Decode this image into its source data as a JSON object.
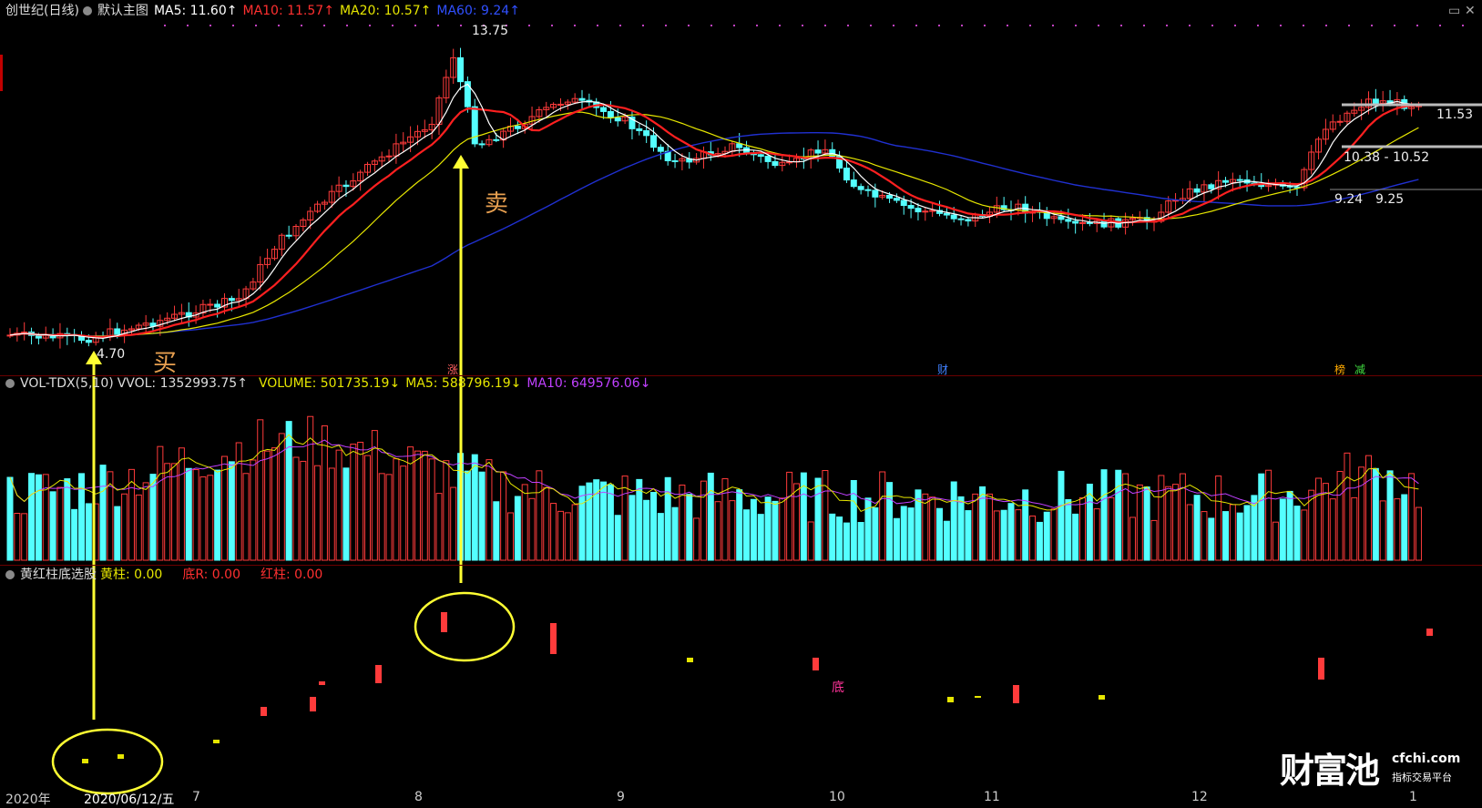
{
  "header_main": {
    "title": "创世纪(日线)",
    "template": "默认主图",
    "ma5": "MA5: 11.60↑",
    "ma10": "MA10: 11.57↑",
    "ma20": "MA20: 10.57↑",
    "ma60": "MA60: 9.24↑"
  },
  "header_vol": {
    "name": "VOL-TDX(5,10)",
    "vvol": "VVOL: 1352993.75↑",
    "volume": "VOLUME: 501735.19↓",
    "ma5": "MA5: 588796.19↓",
    "ma10": "MA10: 649576.06↓"
  },
  "header_ind": {
    "name": "黄红柱底选股",
    "yellow": "黄柱: 0.00",
    "bottom": "底R: 0.00",
    "red": "红柱: 0.00"
  },
  "price_labels": {
    "high": "13.75",
    "low": "4.70",
    "right": "11.53",
    "range": "10.38 - 10.52",
    "ma60_a": "9.24",
    "ma60_b": "9.25"
  },
  "annotations": {
    "buy": "买",
    "sell": "卖",
    "bottom": "底"
  },
  "event_marks": {
    "zhang": "涨",
    "cai": "财",
    "bang": "榜",
    "jian": "减"
  },
  "x_axis": {
    "year": "2020年",
    "cursor_date": "2020/06/12/五",
    "months": [
      "7",
      "8",
      "9",
      "10",
      "11",
      "12",
      "1"
    ]
  },
  "logo": {
    "main": "财富池",
    "site": "cfchi.com",
    "slogan": "指标交易平台"
  },
  "colors": {
    "up": "#ff3b3b",
    "down": "#54ffff",
    "ma5": "#ffffff",
    "ma10": "#ff2020",
    "ma20": "#e6e600",
    "ma60": "#2030d0",
    "vol_ma10": "#c040ff",
    "arrow": "#ffff33"
  },
  "icons": [
    "collapse-dot-icon",
    "settings-arrow-icon",
    "maximize-icon",
    "close-icon"
  ]
}
